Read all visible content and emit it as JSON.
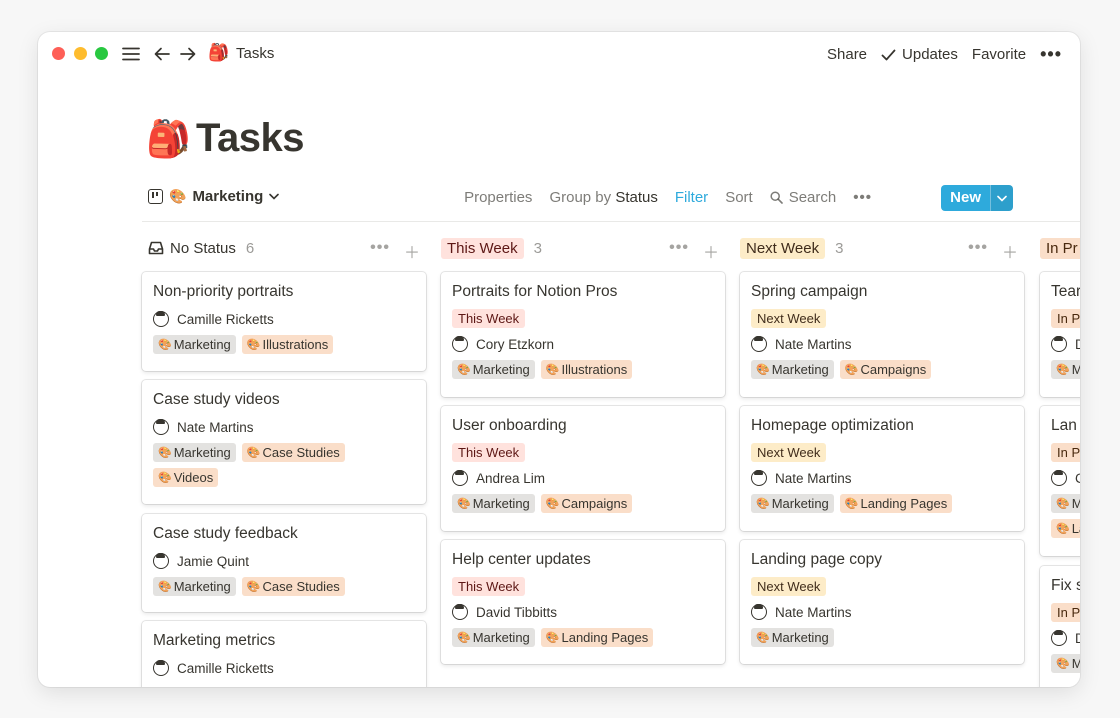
{
  "titlebar": {
    "page_icon": "🎒",
    "page_title": "Tasks",
    "share": "Share",
    "updates": "Updates",
    "favorite": "Favorite",
    "more": "•••"
  },
  "page": {
    "emoji": "🎒",
    "title": "Tasks"
  },
  "view": {
    "name": "Marketing",
    "name_emoji": "🎨",
    "properties": "Properties",
    "group_by_prefix": "Group by",
    "group_by_value": "Status",
    "filter": "Filter",
    "sort": "Sort",
    "search": "Search",
    "more": "•••",
    "new": "New"
  },
  "colors": {
    "accent": "#2eaadc",
    "red_tag": "#ffe2dd",
    "yellow_tag": "#fdecc8",
    "gray_tag": "#e3e2e0",
    "orange_tag": "#fadec9"
  },
  "columns": [
    {
      "label": "No Status",
      "count": "6",
      "cards": [
        {
          "title": "Non-priority portraits",
          "person": "Camille Ricketts",
          "tags": [
            "Marketing",
            "Illustrations"
          ]
        },
        {
          "title": "Case study videos",
          "person": "Nate Martins",
          "tags": [
            "Marketing",
            "Case Studies",
            "Videos"
          ]
        },
        {
          "title": "Case study feedback",
          "person": "Jamie Quint",
          "tags": [
            "Marketing",
            "Case Studies"
          ]
        },
        {
          "title": "Marketing metrics",
          "person": "Camille Ricketts",
          "tags": []
        }
      ]
    },
    {
      "label": "This Week",
      "count": "3",
      "cards": [
        {
          "title": "Portraits for Notion Pros",
          "status": "This Week",
          "person": "Cory Etzkorn",
          "tags": [
            "Marketing",
            "Illustrations"
          ]
        },
        {
          "title": "User onboarding",
          "status": "This Week",
          "person": "Andrea Lim",
          "tags": [
            "Marketing",
            "Campaigns"
          ]
        },
        {
          "title": "Help center updates",
          "status": "This Week",
          "person": "David Tibbitts",
          "tags": [
            "Marketing",
            "Landing Pages"
          ]
        }
      ]
    },
    {
      "label": "Next Week",
      "count": "3",
      "cards": [
        {
          "title": "Spring campaign",
          "status": "Next Week",
          "person": "Nate Martins",
          "tags": [
            "Marketing",
            "Campaigns"
          ]
        },
        {
          "title": "Homepage optimization",
          "status": "Next Week",
          "person": "Nate Martins",
          "tags": [
            "Marketing",
            "Landing Pages"
          ]
        },
        {
          "title": "Landing page copy",
          "status": "Next Week",
          "person": "Nate Martins",
          "tags": [
            "Marketing"
          ]
        }
      ]
    },
    {
      "label": "In Pr",
      "cards": [
        {
          "title": "Tear",
          "status": "In P",
          "person": "D",
          "tags": [
            "M"
          ]
        },
        {
          "title": "Lan",
          "status": "In P",
          "person": "C",
          "tags": [
            "M",
            "La"
          ]
        },
        {
          "title": "Fix s",
          "status": "In P",
          "person": "D",
          "tags": [
            "M"
          ]
        }
      ]
    }
  ]
}
